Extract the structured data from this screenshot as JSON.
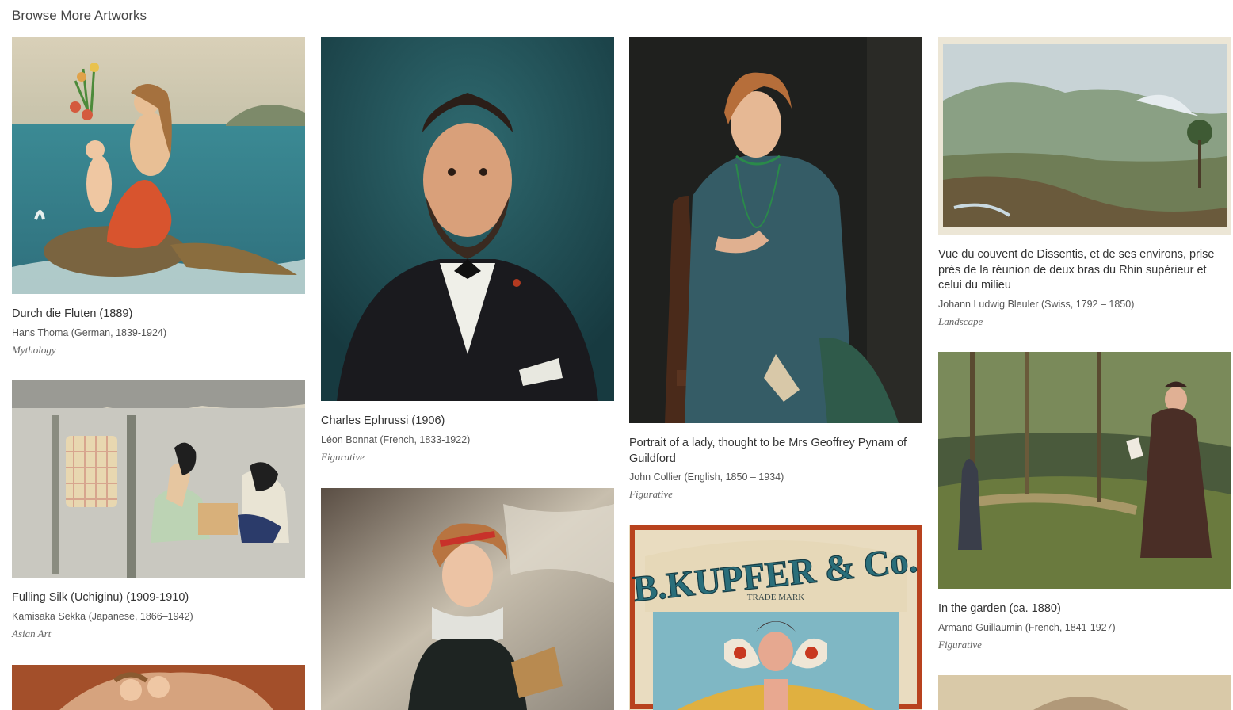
{
  "page": {
    "title": "Browse More Artworks"
  },
  "artworks": [
    {
      "title": "Durch die Fluten (1889)",
      "artist": "Hans Thoma (German, 1839-1924)",
      "genre": "Mythology"
    },
    {
      "title": "Fulling Silk (Uchiginu) (1909-1910)",
      "artist": "Kamisaka Sekka (Japanese, 1866–1942)",
      "genre": "Asian Art"
    },
    {
      "title": "Charles Ephrussi (1906)",
      "artist": "Léon Bonnat (French, 1833-1922)",
      "genre": "Figurative"
    },
    {
      "title": "Portrait of a lady, thought to be Mrs Geoffrey Pynam of Guildford",
      "artist": "John Collier (English, 1850 – 1934)",
      "genre": "Figurative"
    },
    {
      "title": "Vue du couvent de Dissentis, et de ses environs, prise près de la réunion de deux bras du Rhin supérieur et celui du milieu",
      "artist": "Johann Ludwig Bleuler (Swiss, 1792 – 1850)",
      "genre": "Landscape"
    },
    {
      "title": "In the garden (ca. 1880)",
      "artist": "Armand Guillaumin (French, 1841-1927)",
      "genre": "Figurative"
    }
  ],
  "poster_text": {
    "brand": "B.KUPFER & Co.",
    "trade_mark": "TRADE MARK"
  },
  "colors": {
    "title_text": "#333333",
    "artist_text": "#555555",
    "genre_text": "#666666"
  }
}
